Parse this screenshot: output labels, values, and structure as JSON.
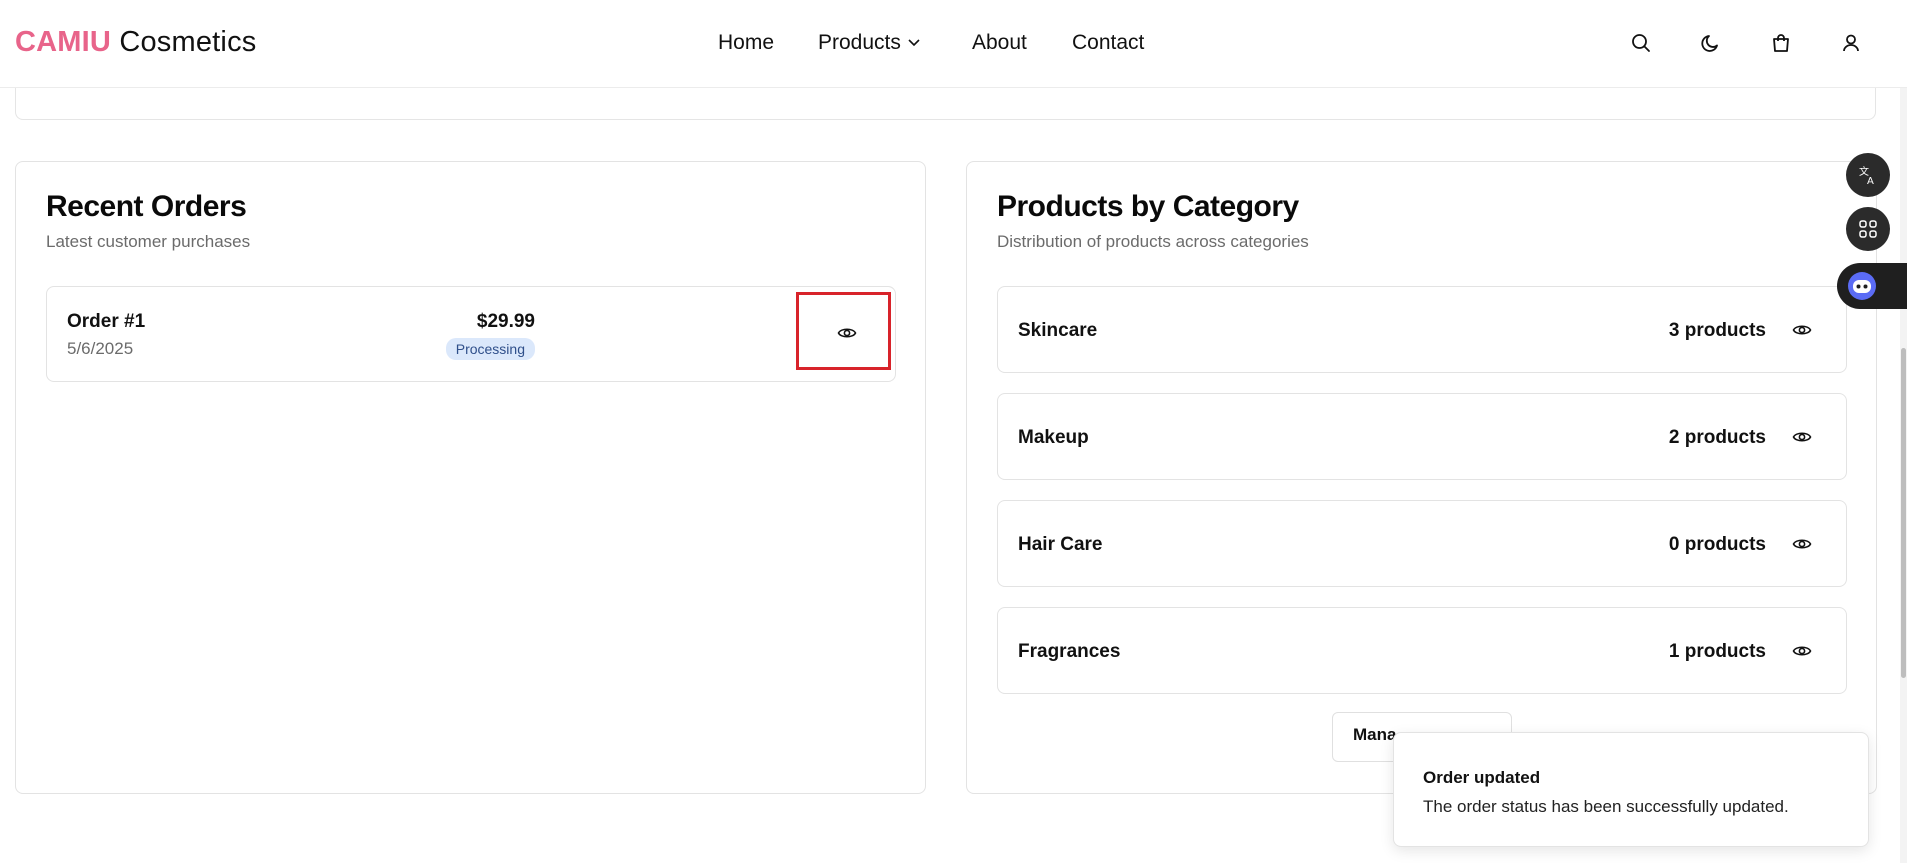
{
  "header": {
    "logo_brand": "CAMIU",
    "logo_rest": "Cosmetics",
    "nav": [
      "Home",
      "Products",
      "About",
      "Contact"
    ],
    "icons": [
      "search-icon",
      "moon-icon",
      "cart-icon",
      "user-icon"
    ]
  },
  "recent_orders": {
    "title": "Recent Orders",
    "subtitle": "Latest customer purchases",
    "orders": [
      {
        "title": "Order #1",
        "date": "5/6/2025",
        "amount": "$29.99",
        "status": "Processing"
      }
    ]
  },
  "categories": {
    "title": "Products by Category",
    "subtitle": "Distribution of products across categories",
    "items": [
      {
        "name": "Skincare",
        "count": "3 products"
      },
      {
        "name": "Makeup",
        "count": "2 products"
      },
      {
        "name": "Hair Care",
        "count": "0 products"
      },
      {
        "name": "Fragrances",
        "count": "1 products"
      }
    ],
    "manage_button": "Mana"
  },
  "toast": {
    "title": "Order updated",
    "description": "The order status has been successfully updated."
  },
  "colors": {
    "brand": "#e8648a",
    "badge_bg": "#dbe8fb",
    "highlight": "#d8232a"
  }
}
